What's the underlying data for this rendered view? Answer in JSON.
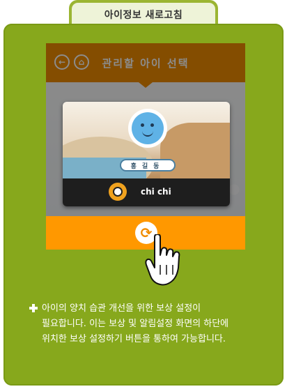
{
  "tab": {
    "title": "아이정보 새로고침"
  },
  "phone": {
    "header_title": "관리할 아이 선택",
    "back_icon": "back-arrow-icon",
    "home_icon": "home-icon",
    "child_card": {
      "name_tag": "홍길동",
      "display_name": "chi chi"
    },
    "refresh_icon": "refresh-icon"
  },
  "description": {
    "line1": "아이의 양치 습관 개선을 위한 보상 설정이",
    "line2": "필요합니다. 이는 보상 및 알림설정 화면의 하단에",
    "line3": "위치한 보상 설정하기 버튼을 통하여 가능합니다."
  },
  "colors": {
    "panel": "#87a81c",
    "header": "#f08c00",
    "action_bar": "#ff9800"
  }
}
